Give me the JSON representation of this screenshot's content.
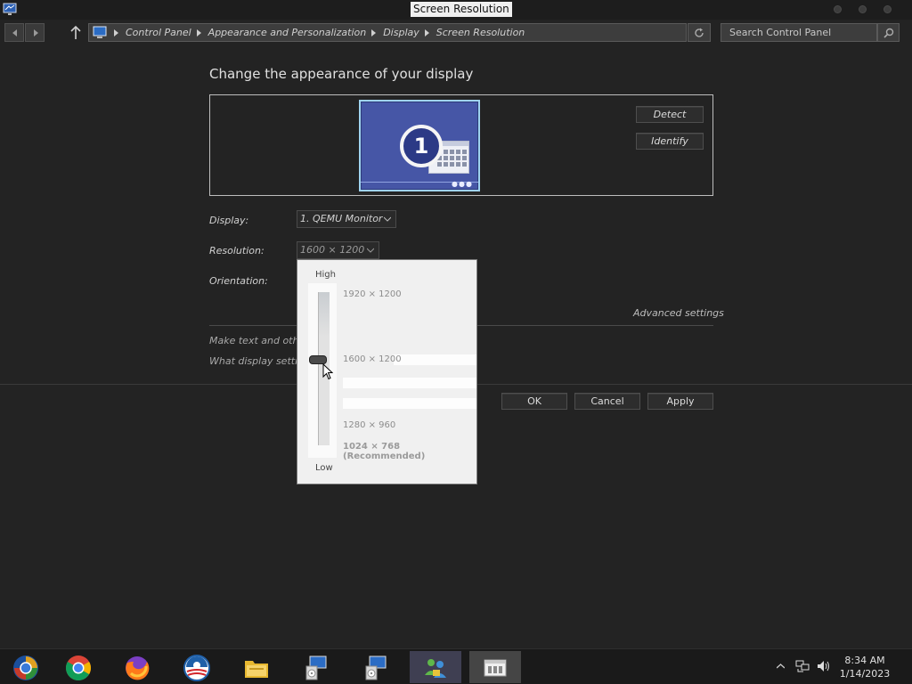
{
  "window": {
    "title": "Screen Resolution"
  },
  "address": {
    "crumbs": [
      "Control Panel",
      "Appearance and Personalization",
      "Display",
      "Screen Resolution"
    ],
    "search_placeholder": "Search Control Panel"
  },
  "main": {
    "heading": "Change the appearance of your display",
    "monitor_number": "1",
    "detect_label": "Detect",
    "identify_label": "Identify",
    "display_label": "Display:",
    "display_value": "1. QEMU Monitor",
    "resolution_label": "Resolution:",
    "resolution_value": "1600 × 1200",
    "orientation_label": "Orientation:",
    "advanced_settings": "Advanced settings",
    "link_text_size": "Make text and other",
    "link_display_settings": "What display setting",
    "ok_label": "OK",
    "cancel_label": "Cancel",
    "apply_label": "Apply"
  },
  "resolution_popup": {
    "high_label": "High",
    "low_label": "Low",
    "options": [
      "1920 × 1200",
      "1600 × 1200",
      "1280 × 960",
      "1024 × 768 (Recommended)"
    ],
    "selected": "1600 × 1200"
  },
  "taskbar": {
    "apps": [
      "windows-orb-icon",
      "chrome-icon",
      "firefox-icon",
      "obama-logo-icon",
      "file-explorer-icon",
      "installer-icon",
      "installer-icon",
      "people-icon",
      "control-panel-icon"
    ],
    "time": "8:34 AM",
    "date": "1/14/2023"
  }
}
